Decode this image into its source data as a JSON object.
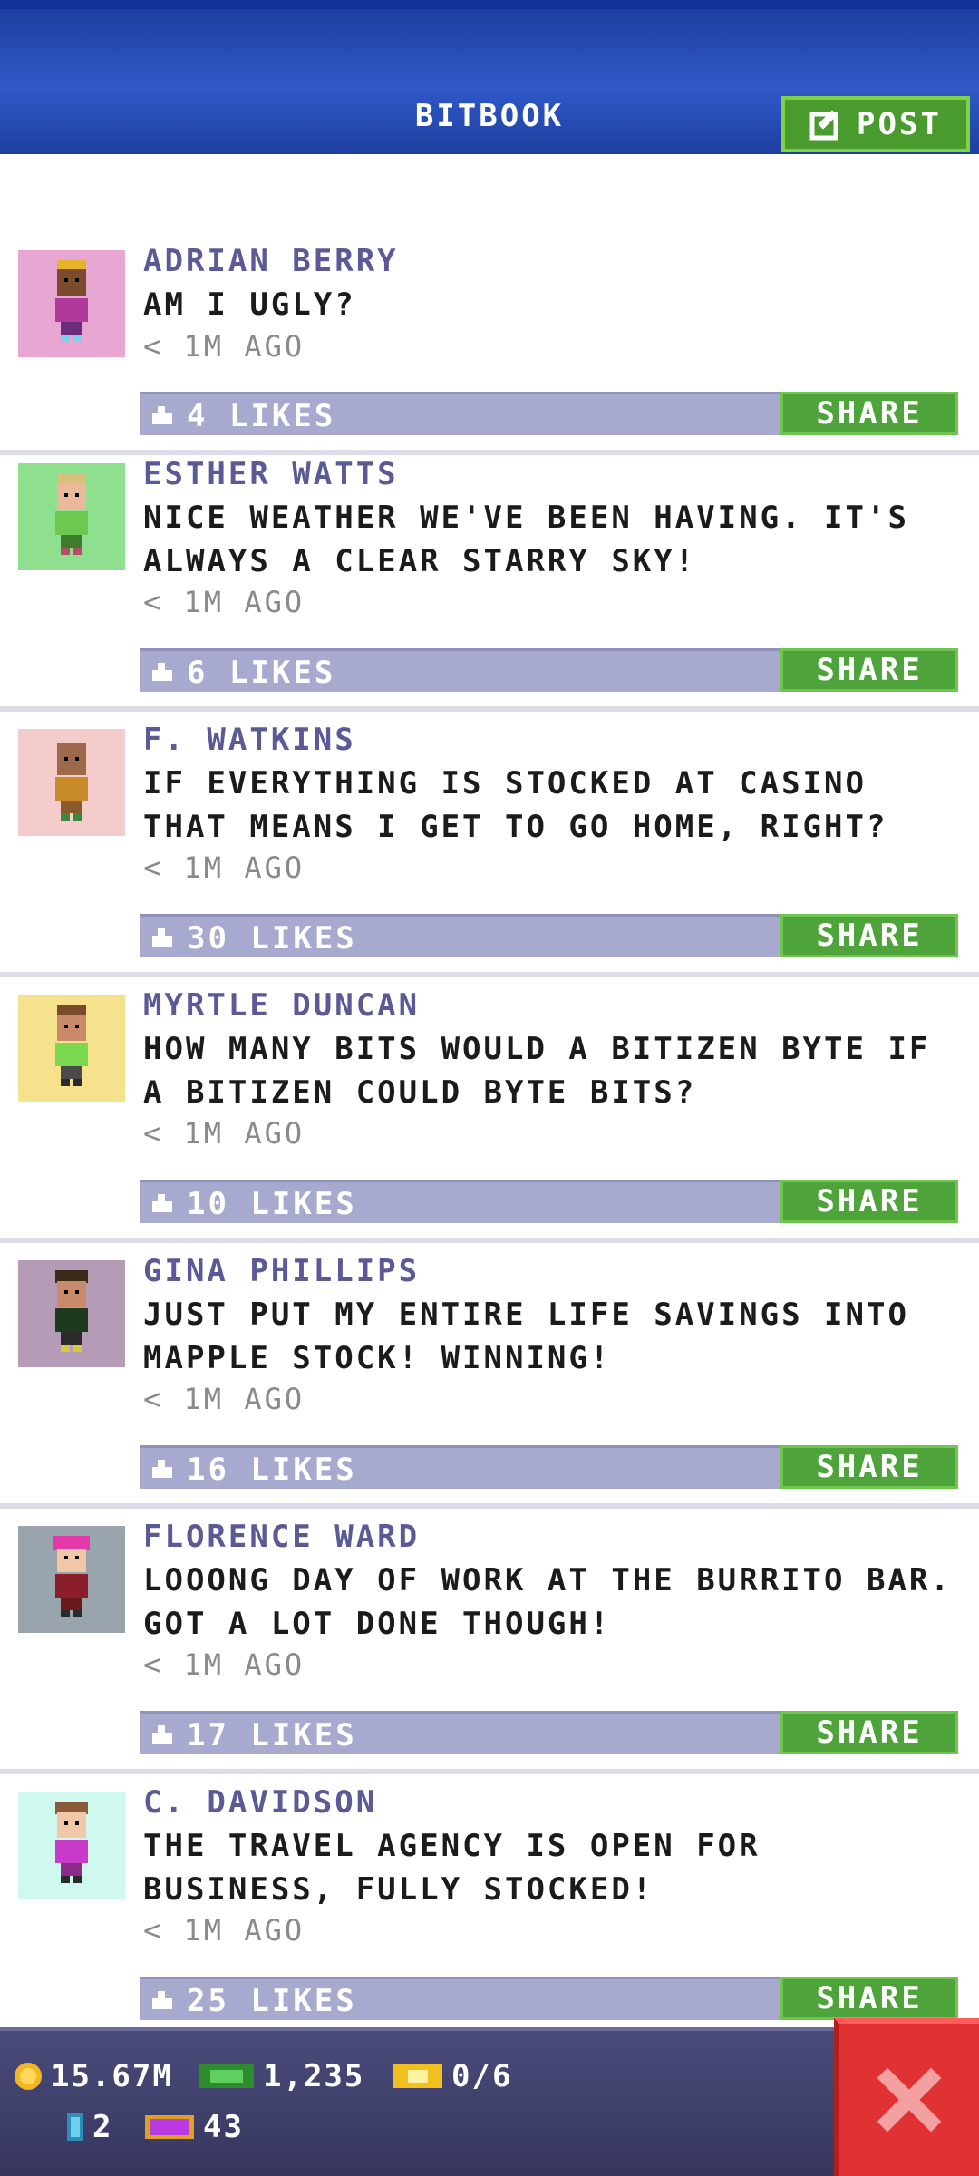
{
  "header": {
    "title": "BITBOOK",
    "post_label": "POST"
  },
  "posts": [
    {
      "name": "ADRIAN BERRY",
      "message": "AM I UGLY?",
      "time": "< 1M AGO",
      "likes": "4 LIKES",
      "share": "SHARE",
      "avatar_bg": "#e8a7d2"
    },
    {
      "name": "ESTHER WATTS",
      "message": "NICE WEATHER WE'VE BEEN HAVING. IT'S ALWAYS A CLEAR STARRY SKY!",
      "time": "< 1M AGO",
      "likes": "6 LIKES",
      "share": "SHARE",
      "avatar_bg": "#8ee08e"
    },
    {
      "name": "F. WATKINS",
      "message": "IF EVERYTHING IS STOCKED AT CASINO THAT MEANS I GET TO GO HOME, RIGHT?",
      "time": "< 1M AGO",
      "likes": "30 LIKES",
      "share": "SHARE",
      "avatar_bg": "#f4cccc"
    },
    {
      "name": "MYRTLE DUNCAN",
      "message": "HOW MANY BITS WOULD A BITIZEN BYTE IF A BITIZEN COULD BYTE BITS?",
      "time": "< 1M AGO",
      "likes": "10 LIKES",
      "share": "SHARE",
      "avatar_bg": "#f6e28c"
    },
    {
      "name": "GINA PHILLIPS",
      "message": "JUST PUT MY ENTIRE LIFE SAVINGS INTO MAPPLE STOCK! WINNING!",
      "time": "< 1M AGO",
      "likes": "16 LIKES",
      "share": "SHARE",
      "avatar_bg": "#b49bb6"
    },
    {
      "name": "FLORENCE WARD",
      "message": "LOOONG DAY OF WORK AT THE BURRITO BAR. GOT A LOT DONE THOUGH!",
      "time": "< 1M AGO",
      "likes": "17 LIKES",
      "share": "SHARE",
      "avatar_bg": "#9aa4ad"
    },
    {
      "name": "C. DAVIDSON",
      "message": "THE TRAVEL AGENCY IS OPEN FOR BUSINESS, FULLY STOCKED!",
      "time": "< 1M AGO",
      "likes": "25 LIKES",
      "share": "SHARE",
      "avatar_bg": "#cff8ef"
    }
  ],
  "status": {
    "coins": "15.67M",
    "bux": "1,235",
    "tickets": "0/6",
    "elevator": "2",
    "vip": "43"
  },
  "colors": {
    "header_blue": "#2f58c8",
    "share_green": "#4ea33a",
    "likes_bar": "#a7a9cf",
    "name_purple": "#5a5a96",
    "close_red": "#e03232"
  },
  "icons": {
    "post": "edit-icon",
    "like": "thumb-up-icon",
    "coin": "coin-icon",
    "bux": "bux-icon",
    "ticket": "ticket-icon",
    "elevator": "elevator-icon",
    "vip": "vip-icon",
    "close": "close-icon"
  }
}
